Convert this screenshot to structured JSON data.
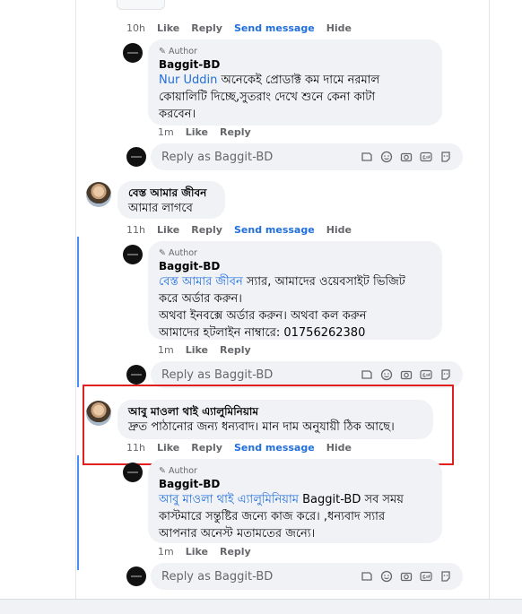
{
  "page_author": "Baggit-BD",
  "labels": {
    "author_tag": "Author",
    "like": "Like",
    "reply": "Reply",
    "send_message": "Send message",
    "hide": "Hide",
    "reply_placeholder": "Reply as Baggit-BD"
  },
  "comments": [
    {
      "time": "10h",
      "actions": [
        "Like",
        "Reply",
        "Send message",
        "Hide"
      ]
    },
    {
      "author": "Baggit-BD",
      "is_author": true,
      "mention": "Nur Uddin",
      "text_lines": [
        "অনেকেই প্রোডাক্ট কম দামে নরমাল",
        "কোয়ালিটি দিচ্ছে,সুতরাং দেখে শুনে কেনা কাটা",
        "করবেন।"
      ],
      "time": "1m",
      "actions": [
        "Like",
        "Reply"
      ]
    },
    {
      "author": "বেস্ত আমার জীবন",
      "text": "আমার লাগবে",
      "time": "11h",
      "actions": [
        "Like",
        "Reply",
        "Send message",
        "Hide"
      ]
    },
    {
      "author": "Baggit-BD",
      "is_author": true,
      "mention": "বেস্ত আমার জীবন",
      "text_lines": [
        "স্যার, আমাদের ওয়েবসাইট ভিজিট",
        "করে অর্ডার করুন।",
        "অথবা ইনবক্সে অর্ডার করুন। অথবা কল করুন",
        "আমাদের হটলাইন নাম্বারে: 01756262380"
      ],
      "time": "1m",
      "actions": [
        "Like",
        "Reply"
      ]
    },
    {
      "author": "আবু মাওলা থাই এ্যালুমিনিয়াম",
      "text": "দ্রুত পাঠানোর জন্য ধন্যবাদ। মান দাম অনুযায়ী ঠিক আছে।",
      "time": "11h",
      "actions": [
        "Like",
        "Reply",
        "Send message",
        "Hide"
      ],
      "highlighted": true
    },
    {
      "author": "Baggit-BD",
      "is_author": true,
      "mention": "আবু মাওলা থাই এ্যালুমিনিয়াম",
      "text_lines": [
        "Baggit-BD সব সময়",
        "কাস্টমারে সন্তুষ্টির জন্যে কাজ করে। ,ধন্যবাদ স্যার",
        "আপনার অনেস্ট মতামতের জন্যে।"
      ],
      "time": "1m",
      "actions": [
        "Like",
        "Reply"
      ]
    }
  ],
  "icons": [
    "sticker-icon",
    "emoji-icon",
    "camera-icon",
    "gif-icon",
    "avatar-sticker-icon"
  ],
  "colors": {
    "link": "#216fdb",
    "thread_line": "#4c8ff2",
    "highlight": "#e02020",
    "bubble": "#f0f2f5"
  }
}
